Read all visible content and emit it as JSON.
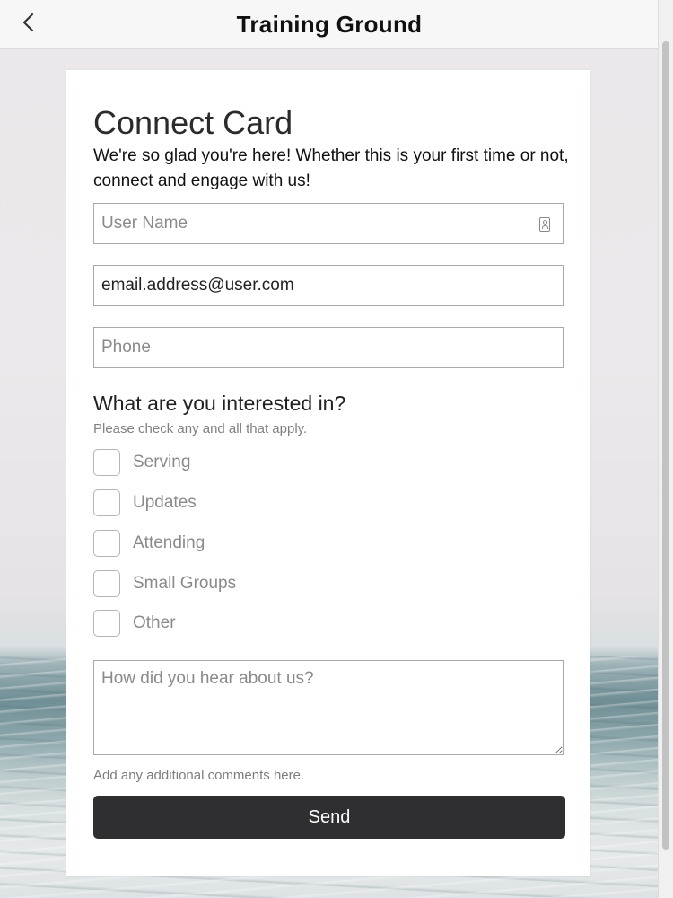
{
  "header": {
    "title": "Training Ground"
  },
  "form": {
    "title": "Connect Card",
    "intro": "We're so glad you're here! Whether this is your first time or not, connect and engage with us!",
    "name_placeholder": "User Name",
    "email_value": "email.address@user.com",
    "phone_placeholder": "Phone",
    "interests_heading": "What are you interested in?",
    "interests_sub": "Please check any and all that apply.",
    "interests": [
      {
        "label": "Serving",
        "checked": false
      },
      {
        "label": "Updates",
        "checked": false
      },
      {
        "label": "Attending",
        "checked": false
      },
      {
        "label": "Small Groups",
        "checked": false
      },
      {
        "label": "Other",
        "checked": false
      }
    ],
    "comments_placeholder": "How did you hear about us?",
    "comments_help": "Add any additional comments here.",
    "send_label": "Send"
  },
  "icons": {
    "back": "chevron-left-icon",
    "contact": "contact-card-icon"
  }
}
